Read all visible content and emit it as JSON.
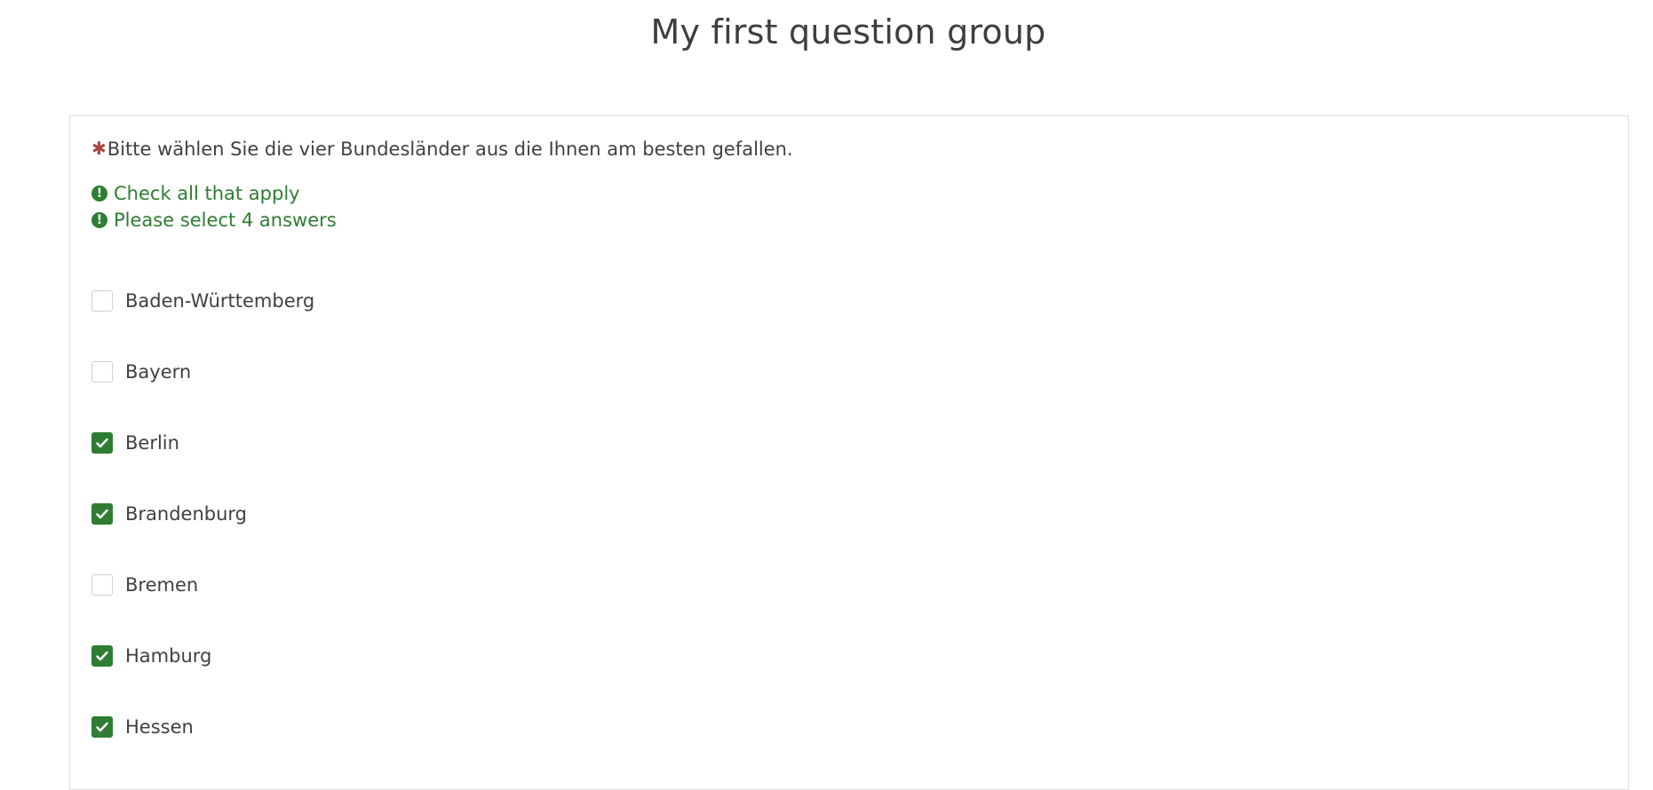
{
  "page": {
    "title": "My first question group"
  },
  "question": {
    "mandatory_marker": "✱",
    "text": "Bitte wählen Sie die vier Bundesländer aus die Ihnen am besten gefallen.",
    "tips": [
      {
        "icon": "exclamation-circle-icon",
        "text": "Check all that apply"
      },
      {
        "icon": "exclamation-circle-icon",
        "text": "Please select 4 answers"
      }
    ],
    "options": [
      {
        "label": "Baden-Württemberg",
        "checked": false
      },
      {
        "label": "Bayern",
        "checked": false
      },
      {
        "label": "Berlin",
        "checked": true
      },
      {
        "label": "Brandenburg",
        "checked": true
      },
      {
        "label": "Bremen",
        "checked": false
      },
      {
        "label": "Hamburg",
        "checked": true
      },
      {
        "label": "Hessen",
        "checked": true
      }
    ]
  },
  "colors": {
    "accent": "#2f7d32",
    "mandatory": "#a94442",
    "text": "#404040"
  }
}
